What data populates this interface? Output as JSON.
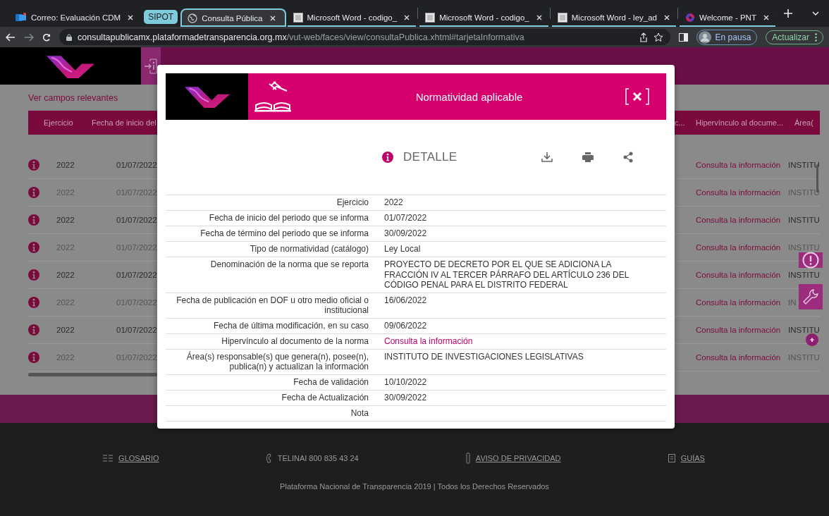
{
  "browser": {
    "tab_group": "SIPOT",
    "tabs": [
      {
        "title": "Correo: Evaluación CDM",
        "kind": "mail",
        "selected": false,
        "grouped": false
      },
      {
        "title": "Consulta Pública",
        "kind": "globe",
        "selected": true,
        "grouped": true
      },
      {
        "title": "Microsoft Word - codigo_",
        "kind": "document",
        "selected": false,
        "grouped": true
      },
      {
        "title": "Microsoft Word - codigo_",
        "kind": "document",
        "selected": false,
        "grouped": true
      },
      {
        "title": "Microsoft Word - ley_ad",
        "kind": "document",
        "selected": false,
        "grouped": true
      },
      {
        "title": "Welcome - PNT",
        "kind": "pnt",
        "selected": false,
        "grouped": true
      }
    ],
    "address": {
      "host": "consultapublicamx.plataformadetransparencia.org.mx",
      "path": "/vut-web/faces/view/consultaPublica.xhtml#tarjetaInformativa"
    },
    "profile": "En pausa",
    "update_button": "Actualizar"
  },
  "page": {
    "relevant_fields_link": "Ver campos relevantes",
    "table": {
      "columns": [
        "Ejercicio",
        "Fecha de inicio del",
        "c...",
        "Hipervínculo al docume...",
        "Área("
      ],
      "rows": [
        {
          "year": "2022",
          "start_date": "01/07/2022",
          "link": "Consulta la información",
          "area": "INSTITU"
        },
        {
          "year": "2022",
          "start_date": "01/07/2022",
          "link": "Consulta la información",
          "area": "INSTITU"
        },
        {
          "year": "2022",
          "start_date": "01/07/2022",
          "link": "Consulta la información",
          "area": "INSTITU"
        },
        {
          "year": "2022",
          "start_date": "01/07/2022",
          "link": "Consulta la información",
          "area": "INSTITU"
        },
        {
          "year": "2022",
          "start_date": "01/07/2022",
          "link": "Consulta la información",
          "area": "INSTITU"
        },
        {
          "year": "2022",
          "start_date": "01/07/2022",
          "link": "Consulta la información",
          "area": "IN"
        },
        {
          "year": "2022",
          "start_date": "01/07/2022",
          "link": "Consulta la información",
          "area": "INSTITU"
        },
        {
          "year": "2022",
          "start_date": "01/07/2022",
          "link": "Consulta la información",
          "area": "INSTITU"
        }
      ]
    }
  },
  "modal": {
    "title": "Normatividad aplicable",
    "section": "DETALLE",
    "fields": [
      {
        "label": "Ejercicio",
        "value": "2022",
        "kind": "text"
      },
      {
        "label": "Fecha de inicio del periodo que se informa",
        "value": "01/07/2022",
        "kind": "text"
      },
      {
        "label": "Fecha de término del periodo que se informa",
        "value": "30/09/2022",
        "kind": "text"
      },
      {
        "label": "Tipo de normatividad (catálogo)",
        "value": "Ley Local",
        "kind": "text"
      },
      {
        "label": "Denominación de la norma que se reporta",
        "value": "PROYECTO DE DECRETO POR EL QUE SE ADICIONA LA FRACCIÓN IV AL TERCER PÁRRAFO DEL ARTÍCULO 236 DEL CÓDIGO PENAL PARA EL DISTRITO FEDERAL",
        "kind": "text"
      },
      {
        "label": "Fecha de publicación en DOF u otro medio oficial o institucional",
        "value": "16/06/2022",
        "kind": "text"
      },
      {
        "label": "Fecha de última modificación, en su caso",
        "value": "09/06/2022",
        "kind": "text"
      },
      {
        "label": "Hipervínculo al documento de la norma",
        "value": "Consulta la información",
        "kind": "link"
      },
      {
        "label": "Área(s) responsable(s) que genera(n), posee(n), publica(n) y actualizan la información",
        "value": "INSTITUTO DE INVESTIGACIONES LEGISLATIVAS",
        "kind": "text"
      },
      {
        "label": "Fecha de validación",
        "value": "10/10/2022",
        "kind": "text"
      },
      {
        "label": "Fecha de Actualización",
        "value": "30/09/2022",
        "kind": "text"
      },
      {
        "label": "Nota",
        "kind": "text"
      }
    ]
  },
  "footer": {
    "links": [
      {
        "label": "GLOSARIO",
        "kind": "glossary",
        "is_link": true
      },
      {
        "label": "TELINAI 800 835 43 24",
        "kind": "phone",
        "is_link": false
      },
      {
        "label": "AVISO DE PRIVACIDAD",
        "kind": "privacy",
        "is_link": true
      },
      {
        "label": "GUÍAS",
        "kind": "guide",
        "is_link": true
      }
    ],
    "copyright": "Plataforma Nacional de Transparencia 2019 | Todos los Derechos Reservados"
  }
}
